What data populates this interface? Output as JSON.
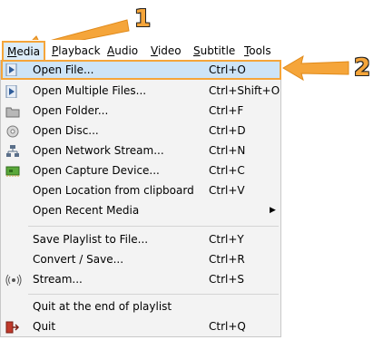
{
  "menubar": {
    "items": [
      "Media",
      "Playback",
      "Audio",
      "Video",
      "Subtitle",
      "Tools"
    ]
  },
  "menu": {
    "items": [
      {
        "label": "Open File...",
        "shortcut": "Ctrl+O",
        "icon": "play-file-icon"
      },
      {
        "label": "Open Multiple Files...",
        "shortcut": "Ctrl+Shift+O",
        "icon": "play-file-icon"
      },
      {
        "label": "Open Folder...",
        "shortcut": "Ctrl+F",
        "icon": "folder-icon"
      },
      {
        "label": "Open Disc...",
        "shortcut": "Ctrl+D",
        "icon": "disc-icon"
      },
      {
        "label": "Open Network Stream...",
        "shortcut": "Ctrl+N",
        "icon": "network-icon"
      },
      {
        "label": "Open Capture Device...",
        "shortcut": "Ctrl+C",
        "icon": "capture-card-icon"
      },
      {
        "label": "Open Location from clipboard",
        "shortcut": "Ctrl+V"
      },
      {
        "label": "Open Recent Media",
        "submenu": true
      },
      {
        "label": "Save Playlist to File...",
        "shortcut": "Ctrl+Y"
      },
      {
        "label": "Convert / Save...",
        "shortcut": "Ctrl+R"
      },
      {
        "label": "Stream...",
        "shortcut": "Ctrl+S",
        "icon": "stream-icon"
      },
      {
        "label": "Quit at the end of playlist"
      },
      {
        "label": "Quit",
        "shortcut": "Ctrl+Q",
        "icon": "quit-icon"
      }
    ]
  },
  "callouts": {
    "one": "1",
    "two": "2"
  },
  "colors": {
    "accent": "#f5a53a",
    "highlight": "#cde4f7"
  }
}
